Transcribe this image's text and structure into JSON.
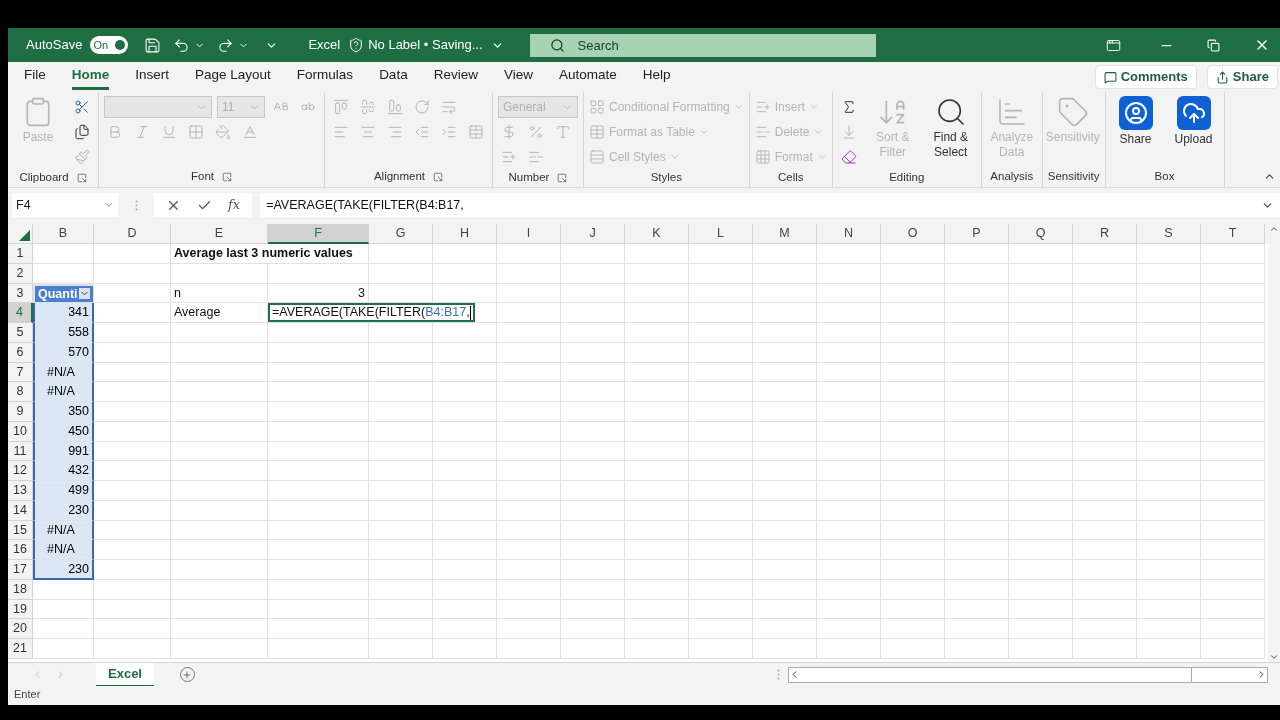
{
  "title_bar": {
    "autosave_label": "AutoSave",
    "autosave": {
      "on": true,
      "label": "On"
    },
    "app": "Excel",
    "document": "No Label • Saving...",
    "search": {
      "placeholder": "Search"
    }
  },
  "menu_tabs": [
    {
      "label": "File",
      "selected": false
    },
    {
      "label": "Home",
      "selected": true
    },
    {
      "label": "Insert",
      "selected": false
    },
    {
      "label": "Page Layout",
      "selected": false
    },
    {
      "label": "Formulas",
      "selected": false
    },
    {
      "label": "Data",
      "selected": false
    },
    {
      "label": "Review",
      "selected": false
    },
    {
      "label": "View",
      "selected": false
    },
    {
      "label": "Automate",
      "selected": false
    },
    {
      "label": "Help",
      "selected": false
    }
  ],
  "menu_buttons": [
    "Comments",
    "Share"
  ],
  "ribbon": [
    {
      "label": "Clipboard",
      "launcher": true,
      "columns": [
        [
          [
            {
              "kind": "large",
              "label": "Paste",
              "disabled": true
            }
          ]
        ],
        [
          [
            {
              "kind": "icon",
              "disabled": false
            }
          ],
          [
            {
              "kind": "icon",
              "disabled": false
            }
          ],
          [
            {
              "kind": "icon",
              "disabled": true
            }
          ]
        ]
      ]
    },
    {
      "label": "Font",
      "launcher": true,
      "columns": [
        [
          [
            {
              "kind": "dropdown",
              "disabled": true
            },
            {
              "kind": "dropdown",
              "value": "11",
              "disabled": true
            },
            {
              "kind": "icon",
              "disabled": true
            },
            {
              "kind": "icon",
              "disabled": true
            }
          ],
          [
            {
              "kind": "icon",
              "disabled": true
            },
            {
              "kind": "icon",
              "disabled": true
            },
            {
              "kind": "icon",
              "disabled": true
            },
            {
              "kind": "icon",
              "disabled": true
            },
            {
              "kind": "icon",
              "disabled": true
            },
            {
              "kind": "icon",
              "disabled": true
            }
          ]
        ]
      ]
    },
    {
      "label": "Alignment",
      "launcher": true,
      "columns": [
        [
          [
            {
              "kind": "icon",
              "disabled": true
            },
            {
              "kind": "icon",
              "disabled": true
            },
            {
              "kind": "icon",
              "disabled": true
            },
            {
              "kind": "icon",
              "disabled": true
            },
            {
              "kind": "icon",
              "disabled": true
            }
          ],
          [
            {
              "kind": "icon",
              "disabled": true
            },
            {
              "kind": "icon",
              "disabled": true
            },
            {
              "kind": "icon",
              "disabled": true
            },
            {
              "kind": "icon",
              "disabled": true
            },
            {
              "kind": "icon",
              "disabled": true
            },
            {
              "kind": "icon",
              "disabled": true
            }
          ]
        ]
      ]
    },
    {
      "label": "Number",
      "launcher": true,
      "columns": [
        [
          [
            {
              "kind": "dropdown",
              "value": "General",
              "disabled": true
            }
          ],
          [
            {
              "kind": "icon",
              "disabled": true
            },
            {
              "kind": "icon",
              "disabled": true
            },
            {
              "kind": "icon",
              "disabled": true
            }
          ],
          [
            {
              "kind": "icon",
              "disabled": true
            },
            {
              "kind": "icon",
              "disabled": true
            }
          ]
        ]
      ]
    },
    {
      "label": "Styles",
      "launcher": false,
      "columns": [
        [
          [
            {
              "kind": "row",
              "label": "Conditional Formatting",
              "disabled": true
            }
          ],
          [
            {
              "kind": "row",
              "label": "Format as Table",
              "disabled": true
            }
          ],
          [
            {
              "kind": "row",
              "label": "Cell Styles",
              "disabled": true
            }
          ]
        ]
      ]
    },
    {
      "label": "Cells",
      "launcher": false,
      "columns": [
        [
          [
            {
              "kind": "row",
              "label": "Insert",
              "disabled": true
            }
          ],
          [
            {
              "kind": "row",
              "label": "Delete",
              "disabled": true
            }
          ],
          [
            {
              "kind": "row",
              "label": "Format",
              "disabled": true
            }
          ]
        ]
      ]
    },
    {
      "label": "Editing",
      "launcher": false,
      "columns": [
        [
          [
            {
              "kind": "icon",
              "disabled": false
            }
          ],
          [
            {
              "kind": "icon",
              "disabled": true
            }
          ],
          [
            {
              "kind": "icon",
              "disabled": false
            }
          ]
        ],
        [
          [
            {
              "kind": "large",
              "label": "Sort & Filter",
              "disabled": true
            }
          ]
        ],
        [
          [
            {
              "kind": "large",
              "label": "Find & Select",
              "disabled": false
            }
          ]
        ]
      ]
    },
    {
      "label": "Analysis",
      "launcher": false,
      "columns": [
        [
          [
            {
              "kind": "large",
              "label": "Analyze Data",
              "disabled": true
            }
          ]
        ]
      ]
    },
    {
      "label": "Sensitivity",
      "launcher": false,
      "columns": [
        [
          [
            {
              "kind": "large",
              "label": "Sensitivity",
              "disabled": true
            }
          ]
        ]
      ]
    },
    {
      "label": "Box",
      "launcher": false,
      "columns": [
        [
          [
            {
              "kind": "large",
              "label": "Share",
              "disabled": false
            }
          ]
        ],
        [
          [
            {
              "kind": "large",
              "label": "Upload",
              "disabled": false
            }
          ]
        ]
      ]
    }
  ],
  "formula_bar": {
    "name_box": "F4",
    "function_label": "fx",
    "formula": "=AVERAGE(TAKE(FILTER(B4:B17,"
  },
  "columns": [
    {
      "label": "B",
      "selected": false
    },
    {
      "label": "D",
      "selected": false
    },
    {
      "label": "E",
      "selected": false
    },
    {
      "label": "F",
      "selected": true
    },
    {
      "label": "G",
      "selected": false
    },
    {
      "label": "H",
      "selected": false
    },
    {
      "label": "I",
      "selected": false
    },
    {
      "label": "J",
      "selected": false
    },
    {
      "label": "K",
      "selected": false
    },
    {
      "label": "L",
      "selected": false
    },
    {
      "label": "M",
      "selected": false
    },
    {
      "label": "N",
      "selected": false
    },
    {
      "label": "O",
      "selected": false
    },
    {
      "label": "P",
      "selected": false
    },
    {
      "label": "Q",
      "selected": false
    },
    {
      "label": "R",
      "selected": false
    },
    {
      "label": "S",
      "selected": false
    },
    {
      "label": "T",
      "selected": false
    }
  ],
  "rows": [
    {
      "label": "1",
      "selected": false,
      "cells": [
        null,
        null,
        {
          "kind": "title",
          "text": "Average last 3 numeric values"
        }
      ]
    },
    {
      "label": "2",
      "selected": false,
      "cells": []
    },
    {
      "label": "3",
      "selected": false,
      "cells": [
        {
          "kind": "table_header",
          "text": "Quanti"
        },
        null,
        {
          "kind": "label",
          "text": "n"
        },
        {
          "kind": "number",
          "text": "3"
        }
      ]
    },
    {
      "label": "4",
      "selected": true,
      "cells": [
        {
          "kind": "table_number",
          "text": "341"
        },
        null,
        {
          "kind": "label",
          "text": "Average"
        },
        {
          "kind": "editing",
          "parts": [
            {
              "text": "=AVERAGE(TAKE(FILTER("
            },
            {
              "text": "B4:B17",
              "color": "#3c6fb6"
            },
            {
              "text": ","
            }
          ]
        }
      ]
    },
    {
      "label": "5",
      "selected": false,
      "cells": [
        {
          "kind": "table_number",
          "text": "558"
        }
      ]
    },
    {
      "label": "6",
      "selected": false,
      "cells": [
        {
          "kind": "table_number",
          "text": "570"
        }
      ]
    },
    {
      "label": "7",
      "selected": false,
      "cells": [
        {
          "kind": "table_error",
          "text": "#N/A"
        }
      ]
    },
    {
      "label": "8",
      "selected": false,
      "cells": [
        {
          "kind": "table_error",
          "text": "#N/A"
        }
      ]
    },
    {
      "label": "9",
      "selected": false,
      "cells": [
        {
          "kind": "table_number",
          "text": "350"
        }
      ]
    },
    {
      "label": "10",
      "selected": false,
      "cells": [
        {
          "kind": "table_number",
          "text": "450"
        }
      ]
    },
    {
      "label": "11",
      "selected": false,
      "cells": [
        {
          "kind": "table_number",
          "text": "991"
        }
      ]
    },
    {
      "label": "12",
      "selected": false,
      "cells": [
        {
          "kind": "table_number",
          "text": "432"
        }
      ]
    },
    {
      "label": "13",
      "selected": false,
      "cells": [
        {
          "kind": "table_number",
          "text": "499"
        }
      ]
    },
    {
      "label": "14",
      "selected": false,
      "cells": [
        {
          "kind": "table_number",
          "text": "230"
        }
      ]
    },
    {
      "label": "15",
      "selected": false,
      "cells": [
        {
          "kind": "table_error",
          "text": "#N/A"
        }
      ]
    },
    {
      "label": "16",
      "selected": false,
      "cells": [
        {
          "kind": "table_error",
          "text": "#N/A"
        }
      ]
    },
    {
      "label": "17",
      "selected": false,
      "cells": [
        {
          "kind": "table_number",
          "text": "230"
        }
      ]
    },
    {
      "label": "18",
      "selected": false,
      "cells": []
    },
    {
      "label": "19",
      "selected": false,
      "cells": []
    },
    {
      "label": "20",
      "selected": false,
      "cells": []
    },
    {
      "label": "21",
      "selected": false,
      "cells": []
    }
  ],
  "sheet_tabs": [
    {
      "label": "Excel",
      "selected": true
    }
  ],
  "status_bar": {
    "mode": "Enter"
  }
}
